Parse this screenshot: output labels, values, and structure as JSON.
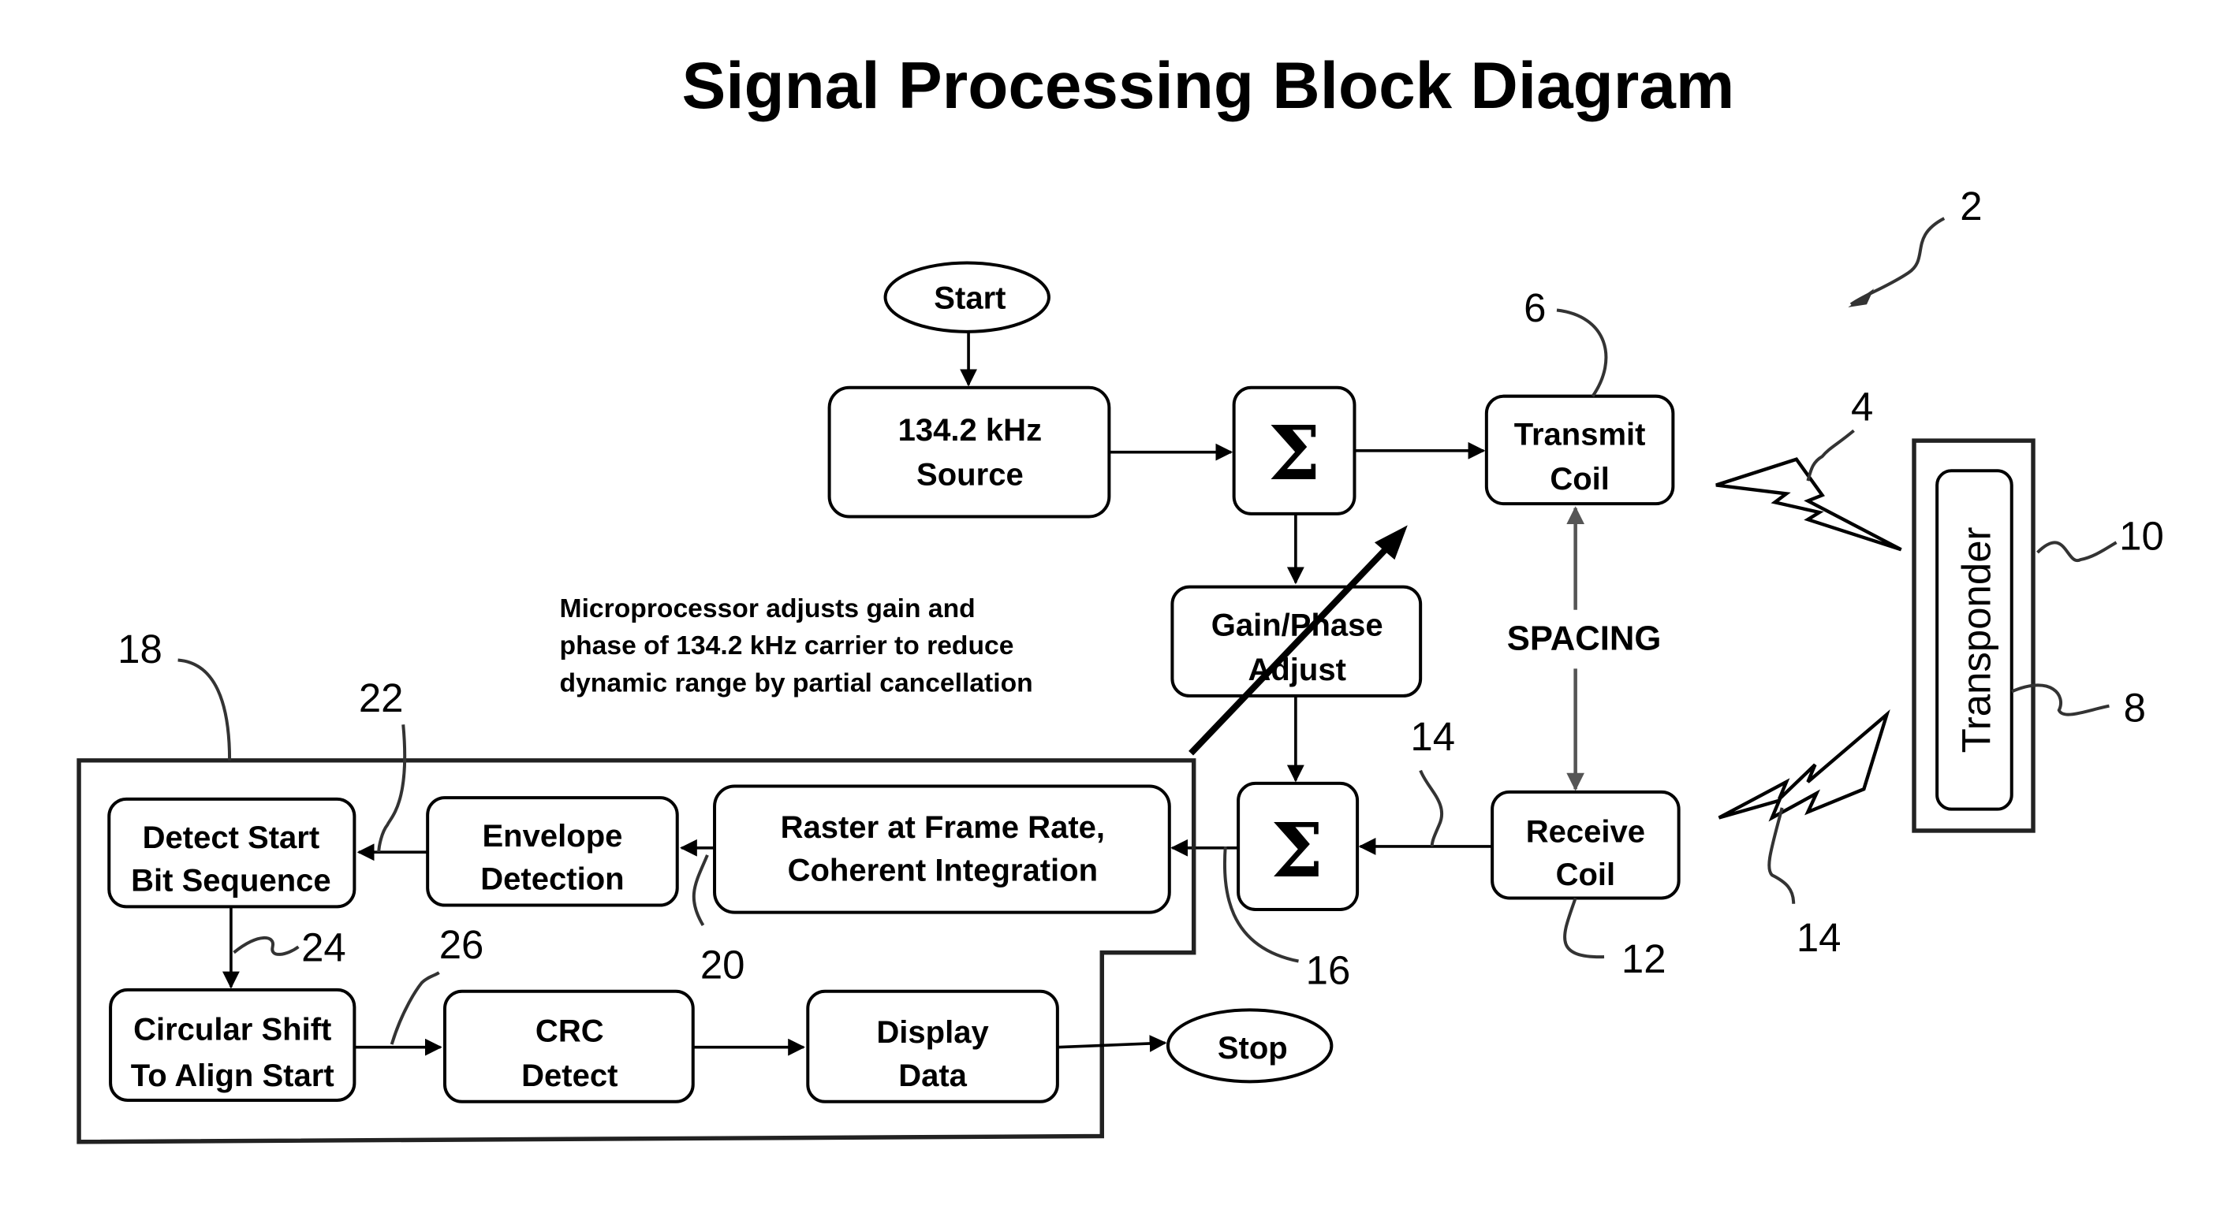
{
  "title": "Signal Processing Block Diagram",
  "terminals": {
    "start": "Start",
    "stop": "Stop"
  },
  "blocks": {
    "source": [
      "134.2 kHz",
      "Source"
    ],
    "sum_top": "Σ",
    "sum_bottom": "Σ",
    "transmit_coil": [
      "Transmit",
      "Coil"
    ],
    "receive_coil": [
      "Receive",
      "Coil"
    ],
    "gain_phase": [
      "Gain/Phase",
      "Adjust"
    ],
    "raster": [
      "Raster at Frame Rate,",
      "Coherent Integration"
    ],
    "envelope": [
      "Envelope",
      "Detection"
    ],
    "detect_start": [
      "Detect Start",
      "Bit Sequence"
    ],
    "circular_shift": [
      "Circular Shift",
      "To Align Start"
    ],
    "crc": [
      "CRC",
      "Detect"
    ],
    "display": [
      "Display",
      "Data"
    ],
    "transponder": "Transponder"
  },
  "labels": {
    "spacing": "SPACING",
    "note": [
      "Microprocessor adjusts gain and",
      "phase of 134.2 kHz carrier to reduce",
      "dynamic range by partial cancellation"
    ]
  },
  "reference_numerals": {
    "system": "2",
    "transmit_field": "4",
    "transmit_coil": "6",
    "transponder_inner": "8",
    "transponder": "10",
    "receive_coil": "12",
    "receive_signal": "14",
    "receive_field": "14",
    "summing_junction": "16",
    "processor": "18",
    "envelope_output": "20",
    "detect_input": "22",
    "shift_input": "24",
    "crc_input": "26"
  }
}
